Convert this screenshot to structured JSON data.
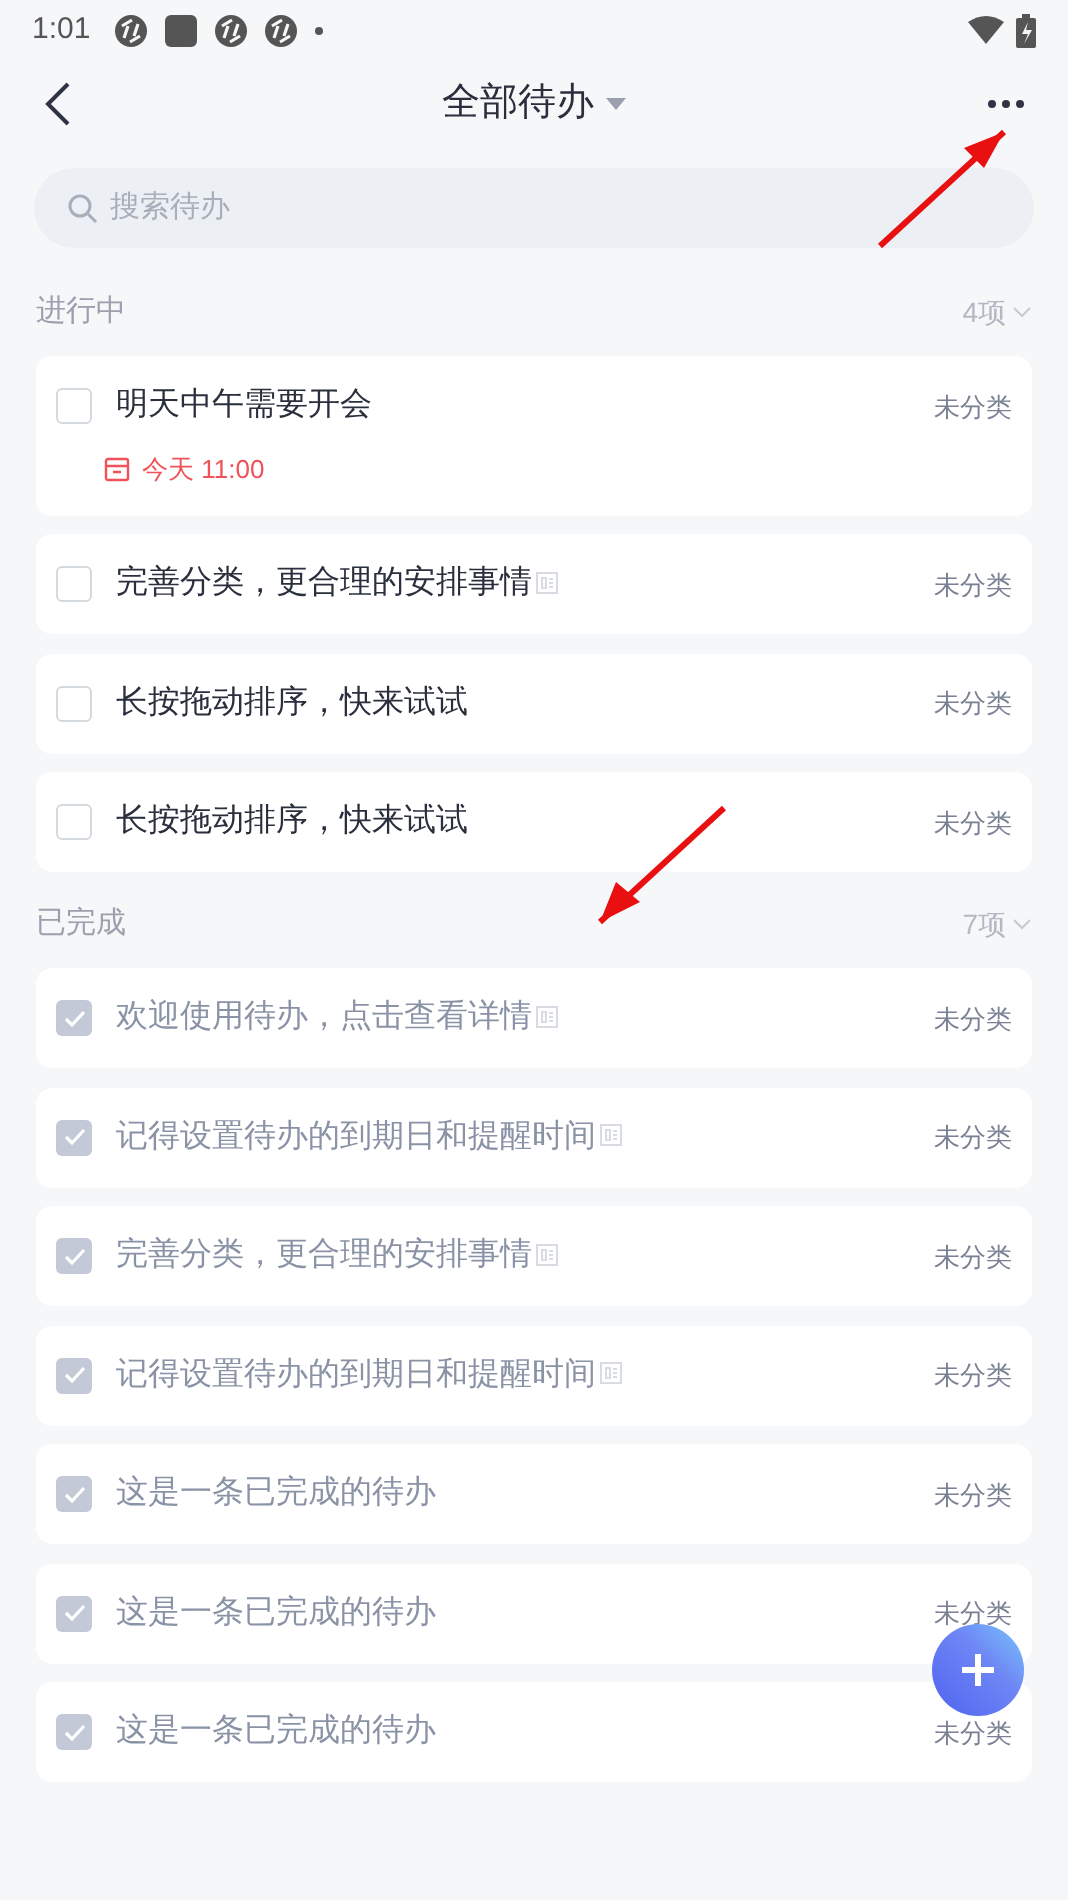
{
  "status_bar": {
    "time": "1:01"
  },
  "header": {
    "title": "全部待办"
  },
  "search": {
    "placeholder": "搜索待办"
  },
  "sections": [
    {
      "title": "进行中",
      "count": "4项",
      "items": [
        {
          "text": "明天中午需要开会",
          "category": "未分类",
          "checked": false,
          "has_note": false,
          "due": "今天 11:00"
        },
        {
          "text": "完善分类，更合理的安排事情",
          "category": "未分类",
          "checked": false,
          "has_note": true
        },
        {
          "text": "长按拖动排序，快来试试",
          "category": "未分类",
          "checked": false,
          "has_note": false
        },
        {
          "text": "长按拖动排序，快来试试",
          "category": "未分类",
          "checked": false,
          "has_note": false
        }
      ]
    },
    {
      "title": "已完成",
      "count": "7项",
      "items": [
        {
          "text": "欢迎使用待办，点击查看详情",
          "category": "未分类",
          "checked": true,
          "has_note": true
        },
        {
          "text": "记得设置待办的到期日和提醒时间",
          "category": "未分类",
          "checked": true,
          "has_note": true
        },
        {
          "text": "完善分类，更合理的安排事情",
          "category": "未分类",
          "checked": true,
          "has_note": true
        },
        {
          "text": "记得设置待办的到期日和提醒时间",
          "category": "未分类",
          "checked": true,
          "has_note": true
        },
        {
          "text": "这是一条已完成的待办",
          "category": "未分类",
          "checked": true,
          "has_note": false
        },
        {
          "text": "这是一条已完成的待办",
          "category": "未分类",
          "checked": true,
          "has_note": false
        },
        {
          "text": "这是一条已完成的待办",
          "category": "未分类",
          "checked": true,
          "has_note": false
        }
      ]
    }
  ]
}
